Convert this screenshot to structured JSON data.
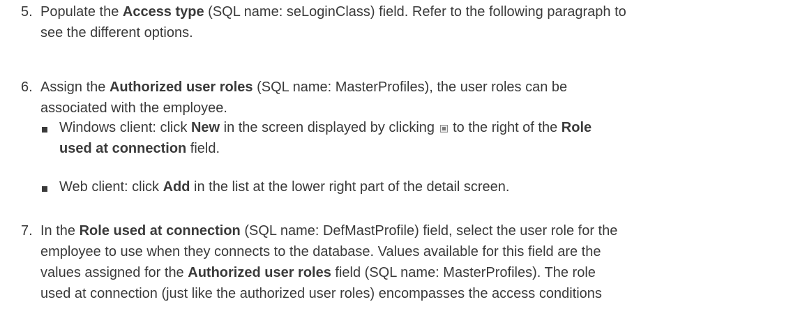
{
  "steps": [
    {
      "number": "5.",
      "line1": {
        "pre": "Populate the ",
        "bold": "Access type",
        "post": " (SQL name: seLoginClass) field. Refer to the following paragraph to"
      },
      "line2": "see the different options."
    },
    {
      "number": "6.",
      "line1": {
        "pre": "Assign the ",
        "bold": "Authorized user roles",
        "post": " (SQL name: MasterProfiles), the user roles can be"
      },
      "line2": "associated with the employee.",
      "bullets": [
        {
          "line1": {
            "pre": "Windows client: click ",
            "bold1": "New",
            "mid": " in the screen displayed by clicking ",
            "icon": "selection-button-icon",
            "mid2": " to the right of the ",
            "bold2": "Role"
          },
          "line2": {
            "bold": "used at connection",
            "post": " field."
          }
        },
        {
          "line1": {
            "pre": "Web client: click ",
            "bold": "Add",
            "post": " in the list at the lower right part of the detail screen."
          }
        }
      ]
    },
    {
      "number": "7.",
      "line1": {
        "pre": "In the ",
        "bold": "Role used at connection",
        "post": " (SQL name: DefMastProfile) field, select the user role for the"
      },
      "line2": "employee to use when they connects to the database. Values available for this field are the",
      "line3": {
        "pre": "values assigned for the ",
        "bold": "Authorized user roles",
        "post": " field (SQL name: MasterProfiles). The role"
      },
      "line4": "used at connection (just like the authorized user roles) encompasses the access conditions"
    }
  ]
}
